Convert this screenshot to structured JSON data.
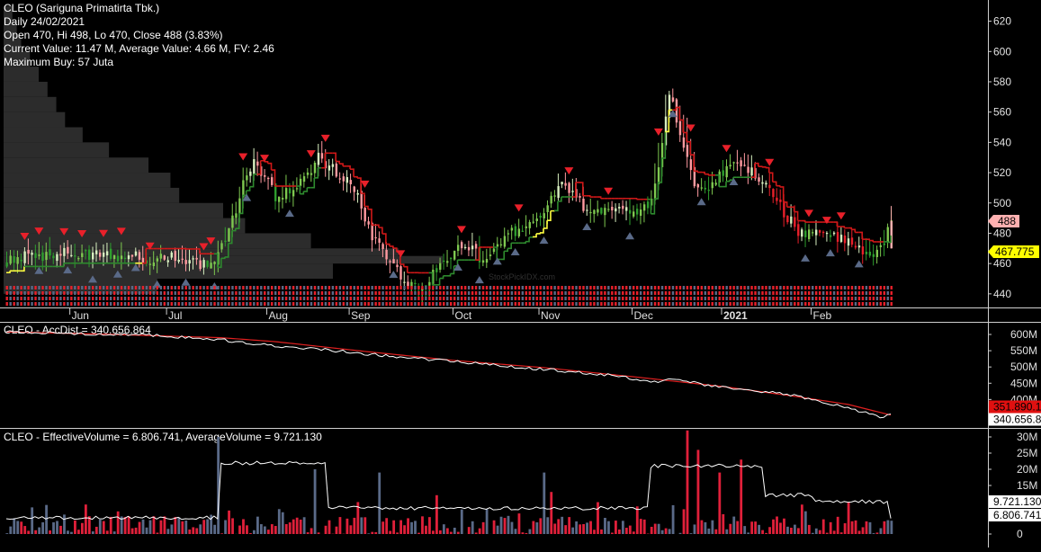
{
  "header": {
    "lines": [
      "CLEO (Sariguna Primatirta Tbk.)",
      "Daily 24/02/2021",
      "Open 470, Hi 498, Lo 470, Close 488 (3.83%)",
      "Current Value: 11.47 M, Average Value: 4.66 M, FV: 2.46",
      "Maximum Buy: 57 Juta"
    ]
  },
  "watermark": "StockPickIDX.com",
  "colors": {
    "background": "#000000",
    "up": "#7ec850",
    "down": "#e8202a",
    "trail_up": "#2e8a2e",
    "trail_down": "#d01818",
    "stop_line": "#ffff40",
    "sell_marker": "#e8202a",
    "buy_marker": "#5a6a88",
    "volume_profile": "#2c2c2c",
    "price_tag_bg": "#ffb0b0",
    "avg_tag_bg": "#ffff00",
    "accdist_line": "#ffffff",
    "accdist_avg": "#e02020",
    "vol_up": "#5a6a88",
    "vol_down": "#e0203a",
    "vol_avg": "#ffffff"
  },
  "chart_data": [
    {
      "type": "candlestick",
      "title": "CLEO (Sariguna Primatirta Tbk.)",
      "xlabel": "",
      "ylabel": "",
      "x_tick_labels": [
        "Jun",
        "Jul",
        "Aug",
        "Sep",
        "Oct",
        "Nov",
        "Dec",
        "2021",
        "Feb"
      ],
      "y_ticks": [
        440,
        460,
        480,
        500,
        520,
        540,
        560,
        580,
        600,
        620
      ],
      "ylim": [
        431,
        634
      ],
      "last_close": 488,
      "last_close_label": "488",
      "trailing_stop": 467.775,
      "trailing_stop_label": "467.775",
      "close_path": [
        [
          0,
          462
        ],
        [
          5,
          466
        ],
        [
          10,
          464
        ],
        [
          15,
          468
        ],
        [
          20,
          464
        ],
        [
          25,
          466
        ],
        [
          30,
          463
        ],
        [
          35,
          466
        ],
        [
          40,
          462
        ],
        [
          45,
          465
        ],
        [
          50,
          462
        ],
        [
          53,
          459
        ],
        [
          58,
          458
        ],
        [
          60,
          470
        ],
        [
          63,
          488
        ],
        [
          66,
          512
        ],
        [
          69,
          525
        ],
        [
          72,
          518
        ],
        [
          75,
          503
        ],
        [
          78,
          506
        ],
        [
          81,
          512
        ],
        [
          84,
          520
        ],
        [
          87,
          530
        ],
        [
          90,
          525
        ],
        [
          93,
          517
        ],
        [
          96,
          512
        ],
        [
          98,
          503
        ],
        [
          100,
          488
        ],
        [
          102,
          478
        ],
        [
          105,
          470
        ],
        [
          108,
          460
        ],
        [
          110,
          452
        ],
        [
          113,
          444
        ],
        [
          116,
          446
        ],
        [
          119,
          454
        ],
        [
          122,
          464
        ],
        [
          125,
          468
        ],
        [
          128,
          472
        ],
        [
          131,
          466
        ],
        [
          134,
          462
        ],
        [
          137,
          470
        ],
        [
          140,
          478
        ],
        [
          143,
          484
        ],
        [
          146,
          486
        ],
        [
          149,
          490
        ],
        [
          152,
          502
        ],
        [
          155,
          512
        ],
        [
          158,
          505
        ],
        [
          161,
          497
        ],
        [
          164,
          494
        ],
        [
          167,
          496
        ],
        [
          170,
          498
        ],
        [
          173,
          495
        ],
        [
          176,
          494
        ],
        [
          179,
          497
        ],
        [
          181,
          510
        ],
        [
          183,
          540
        ],
        [
          185,
          575
        ],
        [
          188,
          545
        ],
        [
          191,
          518
        ],
        [
          194,
          508
        ],
        [
          197,
          512
        ],
        [
          200,
          520
        ],
        [
          203,
          525
        ],
        [
          206,
          525
        ],
        [
          209,
          520
        ],
        [
          212,
          512
        ],
        [
          215,
          500
        ],
        [
          218,
          490
        ],
        [
          221,
          482
        ],
        [
          224,
          480
        ],
        [
          227,
          482
        ],
        [
          230,
          478
        ],
        [
          233,
          478
        ],
        [
          236,
          472
        ],
        [
          239,
          470
        ],
        [
          242,
          466
        ],
        [
          245,
          475
        ],
        [
          247,
          488
        ]
      ],
      "sell_signal_bars": [
        5,
        9,
        16,
        21,
        27,
        32,
        40,
        55,
        57,
        66,
        72,
        85,
        89,
        100,
        110,
        127,
        143,
        157,
        168,
        182,
        191,
        201,
        213,
        224,
        229,
        233
      ],
      "buy_signal_bars": [
        9,
        17,
        24,
        31,
        36,
        42,
        50,
        58,
        67,
        79,
        108,
        126,
        132,
        137,
        142,
        150,
        162,
        174,
        186,
        194,
        203,
        223,
        230,
        238
      ],
      "volume_profile": [
        {
          "price": 630,
          "length": 0.02
        },
        {
          "price": 620,
          "length": 0.03
        },
        {
          "price": 610,
          "length": 0.04
        },
        {
          "price": 600,
          "length": 0.06
        },
        {
          "price": 590,
          "length": 0.08
        },
        {
          "price": 580,
          "length": 0.1
        },
        {
          "price": 570,
          "length": 0.12
        },
        {
          "price": 560,
          "length": 0.14
        },
        {
          "price": 550,
          "length": 0.18
        },
        {
          "price": 540,
          "length": 0.24
        },
        {
          "price": 530,
          "length": 0.33
        },
        {
          "price": 520,
          "length": 0.38
        },
        {
          "price": 510,
          "length": 0.4
        },
        {
          "price": 500,
          "length": 0.5
        },
        {
          "price": 490,
          "length": 0.55
        },
        {
          "price": 480,
          "length": 0.7
        },
        {
          "price": 470,
          "length": 0.9
        },
        {
          "price": 465,
          "length": 1.0
        },
        {
          "price": 460,
          "length": 0.75
        },
        {
          "price": 450,
          "length": 0.35
        },
        {
          "price": 440,
          "length": 0.1
        }
      ]
    },
    {
      "type": "line",
      "title": "CLEO - AccDist = 340.656.864",
      "y_tick_labels": [
        "600M",
        "550M",
        "500M",
        "450M",
        "400M"
      ],
      "y_ticks": [
        600,
        550,
        500,
        450,
        400
      ],
      "ylim": [
        318,
        636
      ],
      "last_value_label": "340.656.8",
      "average_label": "351.890.1",
      "series": [
        {
          "values_path": [
            [
              0,
              607
            ],
            [
              20,
              603
            ],
            [
              40,
              598
            ],
            [
              60,
              584
            ],
            [
              70,
              570
            ],
            [
              90,
              552
            ],
            [
              110,
              530
            ],
            [
              130,
              512
            ],
            [
              150,
              493
            ],
            [
              170,
              473
            ],
            [
              181,
              452
            ],
            [
              187,
              465
            ],
            [
              195,
              445
            ],
            [
              215,
              420
            ],
            [
              225,
              402
            ],
            [
              235,
              375
            ],
            [
              240,
              358
            ],
            [
              244,
              345
            ],
            [
              247,
              352
            ]
          ]
        },
        {
          "values_path": [
            [
              0,
              608
            ],
            [
              30,
              600
            ],
            [
              60,
              590
            ],
            [
              75,
              578
            ],
            [
              100,
              548
            ],
            [
              125,
              520
            ],
            [
              150,
              498
            ],
            [
              175,
              470
            ],
            [
              200,
              440
            ],
            [
              220,
              410
            ],
            [
              235,
              385
            ],
            [
              247,
              352
            ]
          ]
        }
      ]
    },
    {
      "type": "bar",
      "title": "CLEO - EffectiveVolume = 6.806.741, AverageVolume = 9.721.130",
      "y_tick_labels": [
        "30M",
        "25M",
        "20M",
        "15M",
        "10M",
        "5M",
        "0"
      ],
      "y_ticks": [
        30,
        25,
        20,
        15,
        10,
        5,
        0
      ],
      "ylim": [
        0,
        32.5
      ],
      "unit": "M",
      "effective_volume_label": "6.806.741",
      "average_volume_label": "9.721.130",
      "average_levels": [
        {
          "from": 0,
          "to": 60,
          "value": 5
        },
        {
          "from": 60,
          "to": 90,
          "value": 22
        },
        {
          "from": 90,
          "to": 180,
          "value": 8
        },
        {
          "from": 180,
          "to": 212,
          "value": 21
        },
        {
          "from": 212,
          "to": 226,
          "value": 12
        },
        {
          "from": 226,
          "to": 247,
          "value": 10
        }
      ],
      "spikes": [
        {
          "bar": 59,
          "value": 30
        },
        {
          "bar": 86,
          "value": 20
        },
        {
          "bar": 104,
          "value": 19
        },
        {
          "bar": 120,
          "value": 12
        },
        {
          "bar": 150,
          "value": 19
        },
        {
          "bar": 152,
          "value": 13
        },
        {
          "bar": 190,
          "value": 32
        },
        {
          "bar": 193,
          "value": 26
        },
        {
          "bar": 199,
          "value": 19
        },
        {
          "bar": 205,
          "value": 23
        }
      ]
    }
  ]
}
